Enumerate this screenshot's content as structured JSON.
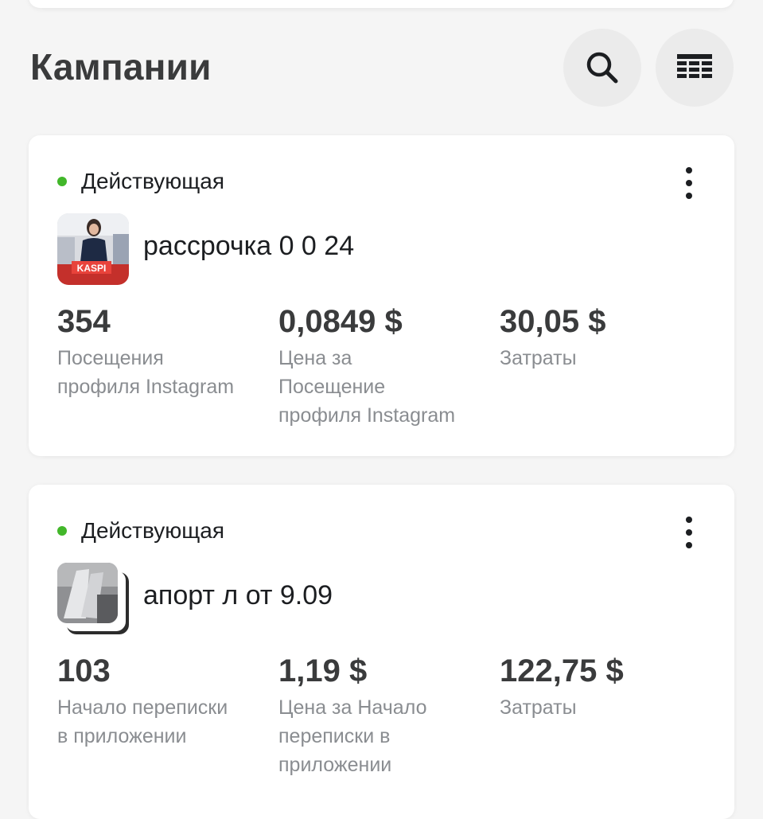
{
  "header": {
    "title": "Кампании",
    "search_icon": "search-icon",
    "table_icon": "table-icon"
  },
  "colors": {
    "background": "#f5f5f5",
    "card": "#ffffff",
    "status_active": "#42b72a",
    "muted_text": "#8a8d91",
    "button_bg": "#ebebeb"
  },
  "campaigns": [
    {
      "status": "Действующая",
      "name": "рассрочка 0 0 24",
      "thumbnail_text": "KASPI",
      "metrics": [
        {
          "value": "354",
          "label": "Посещения\nпрофиля Instagram"
        },
        {
          "value": "0,0849 $",
          "label": "Цена за\nПосещение\nпрофиля Instagram"
        },
        {
          "value": "30,05 $",
          "label": "Затраты"
        }
      ]
    },
    {
      "status": "Действующая",
      "name": "апорт л от 9.09",
      "metrics": [
        {
          "value": "103",
          "label": "Начало переписки\nв приложении"
        },
        {
          "value": "1,19 $",
          "label": "Цена за Начало\nпереписки в\nприложении"
        },
        {
          "value": "122,75 $",
          "label": "Затраты"
        }
      ]
    }
  ]
}
